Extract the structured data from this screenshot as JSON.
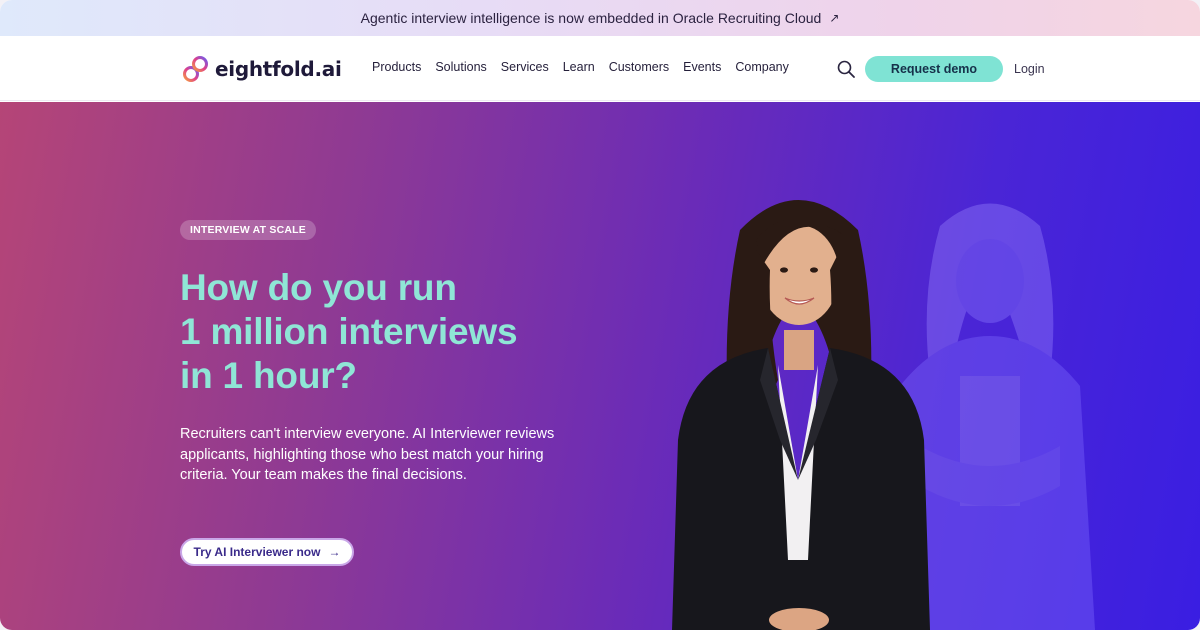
{
  "announcement": {
    "text": "Agentic interview intelligence is now embedded in Oracle Recruiting Cloud",
    "arrow_icon": "arrow-up-right-icon"
  },
  "nav": {
    "logo_text": "eightfold.ai",
    "menu": [
      "Products",
      "Solutions",
      "Services",
      "Learn",
      "Customers",
      "Events",
      "Company"
    ],
    "search_icon": "search-icon",
    "demo_label": "Request demo",
    "login_label": "Login"
  },
  "hero": {
    "badge": "INTERVIEW AT SCALE",
    "headline": [
      "How do you run",
      "1 million interviews",
      "in 1 hour?"
    ],
    "description": "Recruiters can't interview everyone. AI Interviewer reviews applicants, highlighting those who best match your hiring criteria. Your team makes the final decisions.",
    "cta_label": "Try AI Interviewer now",
    "cta_icon": "arrow-right-icon"
  },
  "colors": {
    "accent": "#7fe3d4",
    "headline": "#8fe6d6",
    "hero_start": "#b54577",
    "hero_end": "#3a1ee2"
  }
}
